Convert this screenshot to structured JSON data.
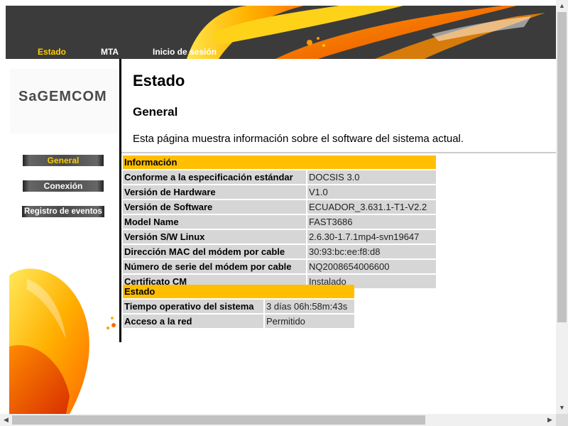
{
  "nav": {
    "items": [
      {
        "label": "Estado"
      },
      {
        "label": "MTA"
      },
      {
        "label": "Inicio de sesión"
      }
    ]
  },
  "brand": {
    "logo": "SaGEMCOM"
  },
  "side": {
    "items": [
      {
        "label": "General"
      },
      {
        "label": "Conexión"
      },
      {
        "label": "Registro de eventos"
      }
    ]
  },
  "main": {
    "title": "Estado",
    "subtitle": "General",
    "description": "Esta página muestra información sobre el software del sistema actual."
  },
  "info": {
    "header": "Información",
    "rows": [
      {
        "label": "Conforme a la especificación estándar",
        "value": "DOCSIS 3.0"
      },
      {
        "label": "Versión de Hardware",
        "value": "V1.0"
      },
      {
        "label": "Versión de Software",
        "value": "ECUADOR_3.631.1-T1-V2.2"
      },
      {
        "label": "Model Name",
        "value": "FAST3686"
      },
      {
        "label": "Versión S/W Linux",
        "value": "2.6.30-1.7.1mp4-svn19647"
      },
      {
        "label": "Dirección MAC del módem por cable",
        "value": "30:93:bc:ee:f8:d8"
      },
      {
        "label": "Número de serie del módem por cable",
        "value": "NQ2008654006600"
      },
      {
        "label": "Certificato CM",
        "value": "Instalado"
      }
    ]
  },
  "estado": {
    "header": "Estado",
    "rows": [
      {
        "label": "Tiempo operativo del sistema",
        "value": "3 días 06h:58m:43s"
      },
      {
        "label": "Acceso a la red",
        "value": "Permitido"
      }
    ]
  },
  "colors": {
    "accent": "#ffbf00",
    "banner": "#3b3b3b",
    "cell": "#d6d6d6"
  }
}
